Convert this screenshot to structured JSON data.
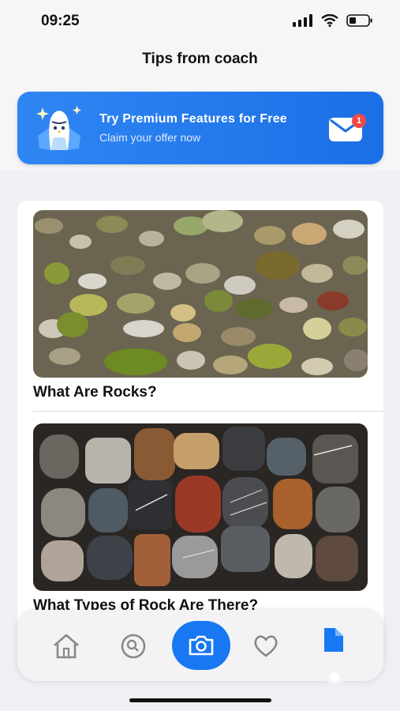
{
  "status_bar": {
    "time": "09:25"
  },
  "header": {
    "title": "Tips from coach"
  },
  "banner": {
    "title": "Try Premium Features for Free",
    "subtitle": "Claim your offer now",
    "mail_badge": "1",
    "accent": "#1b6fe6"
  },
  "articles": [
    {
      "title": "What Are Rocks?",
      "image": "river-pebbles-photo"
    },
    {
      "title": "What Types of Rock Are There?",
      "image": "polished-rocks-grid-photo"
    }
  ],
  "tabbar": {
    "items": [
      {
        "icon": "home-icon"
      },
      {
        "icon": "search-icon"
      },
      {
        "icon": "camera-icon"
      },
      {
        "icon": "heart-icon"
      },
      {
        "icon": "document-icon"
      }
    ],
    "active_color": "#1877f2"
  }
}
